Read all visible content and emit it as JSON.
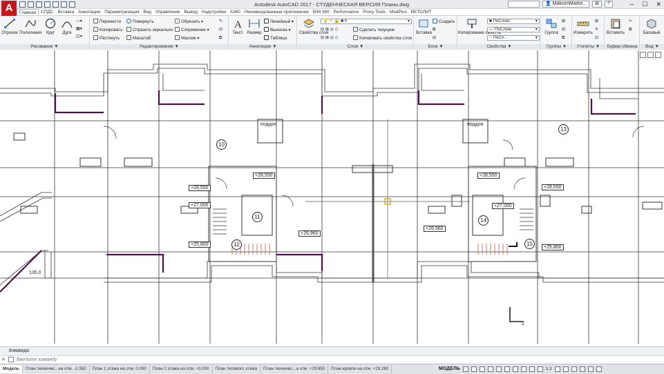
{
  "titlebar": {
    "logo": "A",
    "title": "Autodesk AutoCAD 2017 - СТУДЕНЧЕСКАЯ ВЕРСИЯ    Планы.dwg",
    "search_placeholder": "",
    "user": "MaksimMarke...",
    "minimize": "─",
    "maximize": "☐",
    "close": "✕"
  },
  "ribbon_tabs": [
    "Главная",
    "СПДС",
    "Вставка",
    "Аннотации",
    "Параметризация",
    "Вид",
    "Управление",
    "Вывод",
    "Надстройки",
    "A360",
    "Рекомендованные приложения",
    "BIM 360",
    "Performance",
    "Proxy Tools",
    "ModPlus",
    "ВЕТОЛИТ"
  ],
  "panels": {
    "draw": {
      "label": "Рисование ▼",
      "line": "Отрезок",
      "polyline": "Полилиния",
      "circle": "Круг",
      "arc": "Дуга"
    },
    "modify": {
      "label": "Редактирование ▼",
      "move": "Перенести",
      "rotate": "Повернуть",
      "trim": "Обрезать",
      "copy": "Копировать",
      "mirror": "Отразить зеркально",
      "fillet": "Сопряжение",
      "stretch": "Растянуть",
      "scale": "Масштаб",
      "array": "Массив"
    },
    "annotation": {
      "label": "Аннотации ▼",
      "text": "Текст",
      "dimension": "Размер",
      "linear": "Линейный",
      "leader": "Выноска",
      "table": "Таблица"
    },
    "layers": {
      "label": "Слои ▼",
      "layer_properties": "Свойства слоя",
      "current_layer": "0",
      "make_current": "Сделать текущим",
      "match_layer": "Копировать свойства слоя"
    },
    "block": {
      "label": "Блок ▼",
      "insert": "Вставка",
      "create": "Создать"
    },
    "properties": {
      "label": "Свойства ▼",
      "match": "Копирование свойств",
      "color": "ПоСлою",
      "lineweight": "ПоСлою",
      "linetype": "ПоСл..."
    },
    "groups": {
      "label": "Группы ▼",
      "group": "Группа"
    },
    "utilities": {
      "label": "Утилиты ▼",
      "measure": "Измерить"
    },
    "clipboard": {
      "label": "Буфер обмена",
      "paste": "Вставить"
    },
    "view": {
      "label": "Вид ▼",
      "base": "Базовый"
    }
  },
  "drawing": {
    "room_labels": [
      "поддон",
      "поддон"
    ],
    "room_numbers": [
      "10",
      "11",
      "12",
      "13",
      "14",
      "15"
    ],
    "levels": [
      "+28,550",
      "+28,550",
      "+27,000",
      "+25,800",
      "+26,960",
      "+28,550",
      "+28,550",
      "+27,000",
      "+26,960",
      "+25,800"
    ],
    "dim_text": "135,0"
  },
  "command": {
    "history": "Команда:",
    "placeholder": "Введите команду",
    "close": "✕"
  },
  "layout_tabs": [
    "Модель",
    "План техничес...на отм. -2.350",
    "План 1 этажа на отм. 0.000",
    "План 2 этажа на отм. +3.000",
    "План типового этажа",
    "План техничес...а отм. +29.650",
    "План кровли на отм. +29.280"
  ],
  "status": {
    "model": "МОДЕЛЬ",
    "scale": "1:1"
  }
}
